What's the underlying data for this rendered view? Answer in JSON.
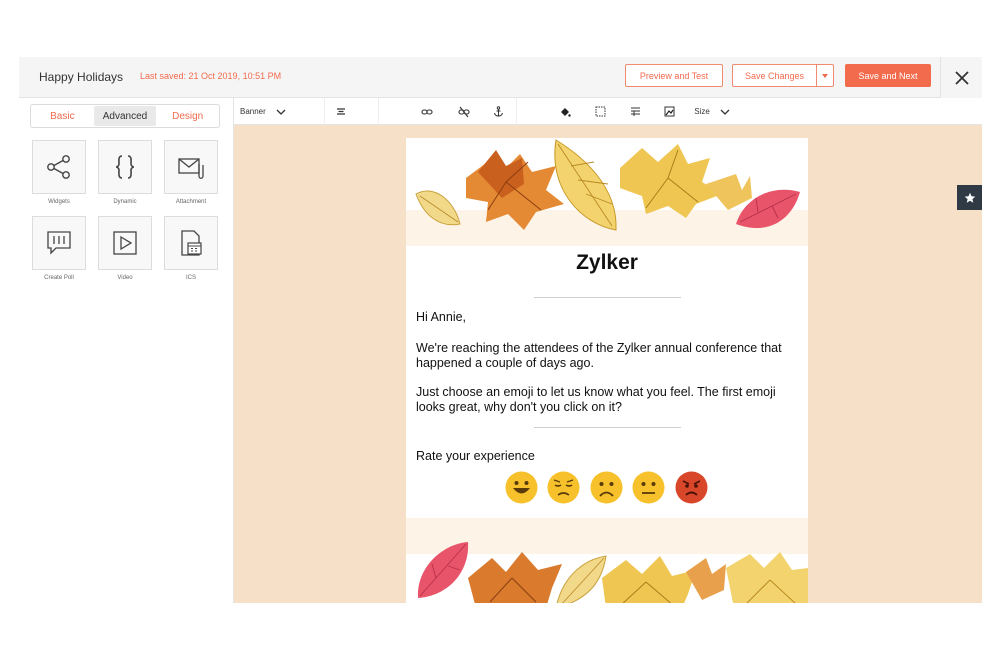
{
  "header": {
    "title": "Happy Holidays",
    "last_saved": "Last saved: 21 Oct 2019, 10:51 PM",
    "preview_label": "Preview and Test",
    "save_changes_label": "Save Changes",
    "save_next_label": "Save and Next",
    "close_icon": "close-icon"
  },
  "left_panel": {
    "tabs": [
      {
        "label": "Basic",
        "active": false
      },
      {
        "label": "Advanced",
        "active": true
      },
      {
        "label": "Design",
        "active": false
      }
    ],
    "tiles": [
      {
        "label": "Widgets",
        "icon": "share-icon"
      },
      {
        "label": "Dynamic",
        "icon": "braces-icon"
      },
      {
        "label": "Attachment",
        "icon": "attachment-icon"
      },
      {
        "label": "Create Poll",
        "icon": "poll-icon"
      },
      {
        "label": "Video",
        "icon": "video-icon"
      },
      {
        "label": "ICS",
        "icon": "calendar-file-icon"
      }
    ]
  },
  "toolbar": {
    "block_type": "Banner",
    "size_label": "Size"
  },
  "email": {
    "brand": "Zylker",
    "greeting": "Hi Annie,",
    "paragraph1": "We're reaching the attendees of the Zylker annual conference that happened a couple of days ago.",
    "paragraph2": "Just choose an emoji to let us know what you feel. The first emoji looks great, why don't you click on it?",
    "rate_label": "Rate your experience",
    "emojis": [
      "grinning",
      "pensive",
      "frowning",
      "neutral",
      "angry"
    ]
  },
  "colors": {
    "accent": "#f26b4d",
    "canvas_bg": "#f6e1c8",
    "emoji_yellow": "#f6c12a",
    "emoji_angry": "#d9472b"
  }
}
